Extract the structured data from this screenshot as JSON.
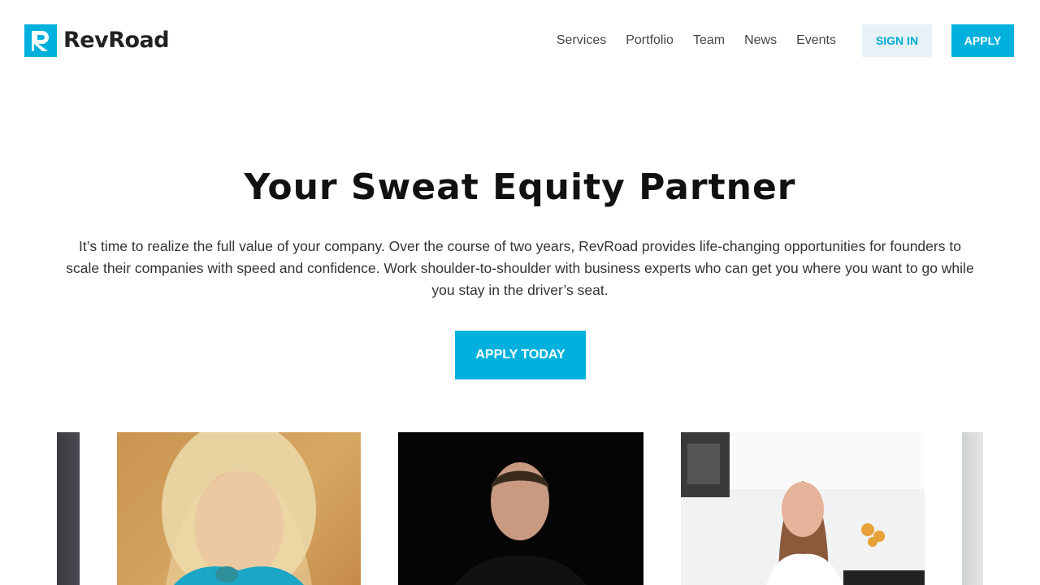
{
  "brand": {
    "name": "RevRoad",
    "accent": "#00b1dd"
  },
  "nav": {
    "links": [
      "Services",
      "Portfolio",
      "Team",
      "News",
      "Events"
    ],
    "signin_label": "SIGN IN",
    "apply_label": "APPLY"
  },
  "hero": {
    "title": "Your Sweat Equity Partner",
    "body": "It’s time to realize the full value of your company. Over the course of two years, RevRoad provides life-changing opportunities for founders to scale their companies with speed and confidence. Work shoulder-to-shoulder with business experts who can get you where you want to go while you stay in the driver’s seat.",
    "cta_label": "APPLY TODAY"
  },
  "gallery": {
    "photos": [
      "founder-photo",
      "founder-photo",
      "founder-photo",
      "founder-photo",
      "founder-photo"
    ]
  },
  "icons": {
    "logo": "revroad-r-logo-icon"
  }
}
